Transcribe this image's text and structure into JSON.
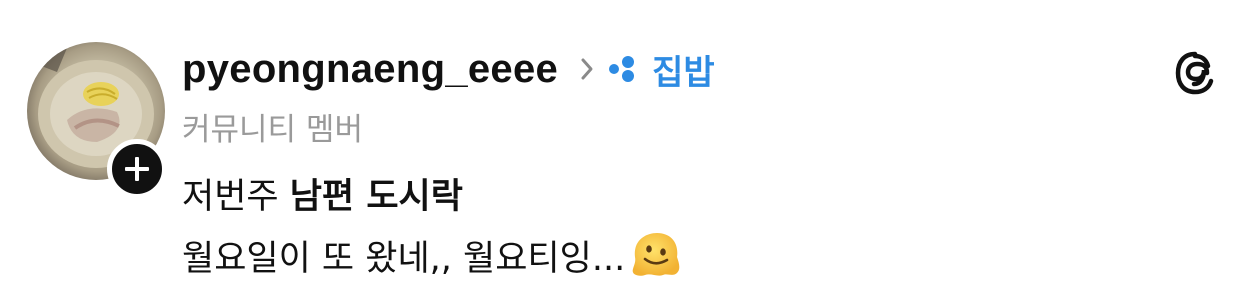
{
  "post": {
    "username": "pyeongnaeng_eeee",
    "community_name": "집밥",
    "role": "커뮤니티 멤버",
    "title_part1": "저번주 ",
    "title_part2": "남편 도시락",
    "body_text": "월요일이 또 왔네,, 월요티잉...",
    "emoji": "melting-face-emoji"
  },
  "icons": {
    "follow": "plus-icon",
    "chevron": "chevron-right-icon",
    "community": "community-dots-icon",
    "app_logo": "threads-logo-icon"
  },
  "colors": {
    "community_accent": "#2d8be3",
    "subtitle_gray": "#9a9a9a",
    "text": "#111111"
  }
}
